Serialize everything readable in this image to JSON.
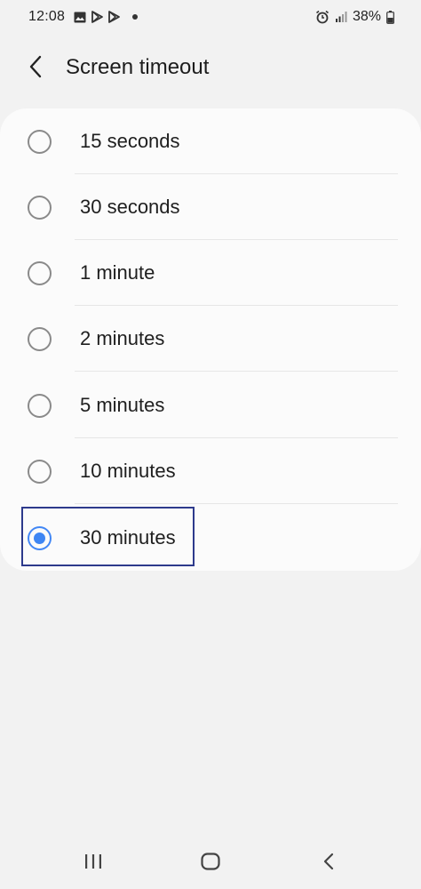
{
  "status_bar": {
    "time": "12:08",
    "battery_percent": "38%",
    "left_icons": [
      "image-icon",
      "play-store-icon",
      "play-store-icon",
      "dot-icon"
    ],
    "right_icons": [
      "alarm-icon",
      "signal-icon",
      "battery-icon"
    ]
  },
  "header": {
    "title": "Screen timeout",
    "back_icon": "chevron-left-icon"
  },
  "options": [
    {
      "label": "15 seconds",
      "selected": false
    },
    {
      "label": "30 seconds",
      "selected": false
    },
    {
      "label": "1 minute",
      "selected": false
    },
    {
      "label": "2 minutes",
      "selected": false
    },
    {
      "label": "5 minutes",
      "selected": false
    },
    {
      "label": "10 minutes",
      "selected": false
    },
    {
      "label": "30 minutes",
      "selected": true
    }
  ],
  "nav_bar": {
    "items": [
      "recent-apps-icon",
      "home-icon",
      "back-icon"
    ]
  },
  "colors": {
    "background": "#f2f2f2",
    "card": "#fbfbfb",
    "accent": "#3e86f3",
    "highlight_border": "#2d3a8c"
  }
}
